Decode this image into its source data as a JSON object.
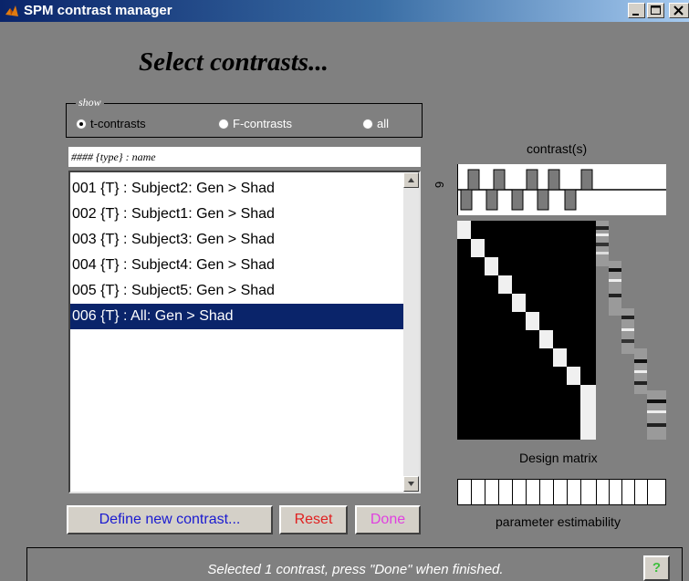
{
  "window": {
    "title": "SPM contrast manager",
    "app_icon": "matlab-icon",
    "controls": [
      "minimize-icon",
      "maximize-icon",
      "close-icon"
    ]
  },
  "heading": "Select contrasts...",
  "show_group": {
    "legend": "show",
    "options": [
      {
        "label": "t-contrasts",
        "selected": true
      },
      {
        "label": "F-contrasts",
        "selected": false
      },
      {
        "label": "all",
        "selected": false
      }
    ]
  },
  "list": {
    "header": "#### {type} : name",
    "items": [
      "001 {T} : Subject2: Gen > Shad",
      "002 {T} : Subject1: Gen > Shad",
      "003 {T} : Subject3: Gen > Shad",
      "004 {T} : Subject4: Gen > Shad",
      "005 {T} : Subject5: Gen > Shad",
      "006 {T} : All: Gen > Shad"
    ],
    "selected_index": 5
  },
  "buttons": {
    "define": "Define new contrast...",
    "reset": "Reset",
    "done": "Done"
  },
  "right_panel": {
    "contrast_label": "contrast(s)",
    "contrast_number": "6",
    "design_label": "Design matrix",
    "estimability_label": "parameter estimability"
  },
  "status": {
    "text": "Selected 1 contrast, press \"Done\" when finished.",
    "help": "?"
  },
  "colors": {
    "panel": "#808080",
    "selection": "#0a246a",
    "define_text": "#1a1ad0",
    "reset_text": "#e02020",
    "done_text": "#e040e0",
    "help_text": "#3fbf3f"
  }
}
